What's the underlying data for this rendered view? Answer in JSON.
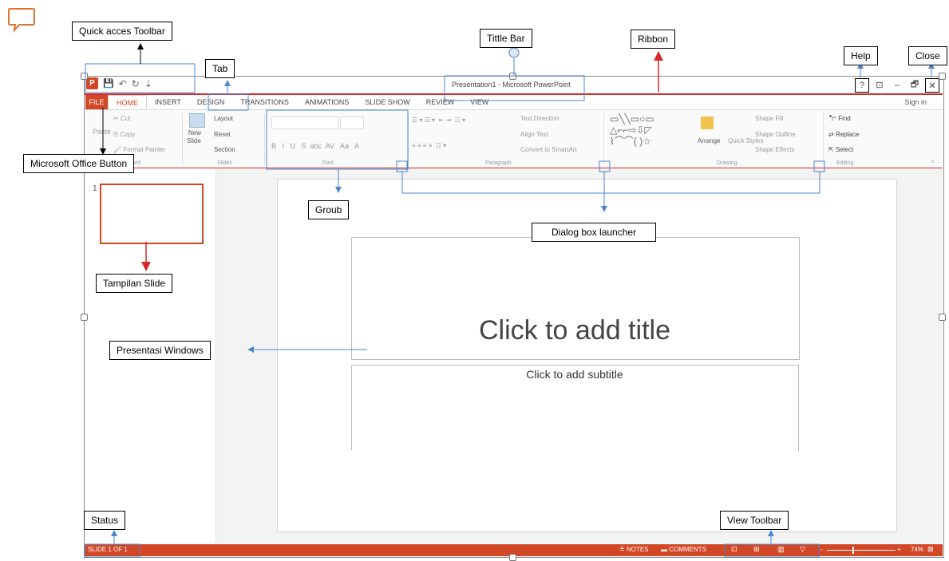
{
  "window": {
    "title": "Presentation1 - Microsoft PowerPoint",
    "controls": {
      "help": "?",
      "restore_ribbon": "⊡",
      "minimize": "–",
      "maximize": "🗗",
      "close": "✕"
    }
  },
  "qat": {
    "logo": "P",
    "save": "💾",
    "undo": "↶",
    "redo": "↻",
    "more": "⇣"
  },
  "tabs": {
    "file": "FILE",
    "home": "HOME",
    "insert": "INSERT",
    "design": "DESIGN",
    "transitions": "TRANSITIONS",
    "animations": "ANIMATIONS",
    "slideshow": "SLIDE SHOW",
    "review": "REVIEW",
    "view": "VIEW",
    "signin": "Sign in"
  },
  "ribbon": {
    "clipboard": {
      "paste": "Paste",
      "cut": "Cut",
      "copy": "Copy",
      "format_painter": "Format Painter",
      "label": "Clipboard"
    },
    "slides": {
      "new_slide": "New",
      "new_slide2": "Slide",
      "layout": "Layout",
      "reset": "Reset",
      "section": "Section",
      "label": "Slides"
    },
    "font": {
      "label": "Font",
      "bold": "B",
      "italic": "I",
      "underline": "U",
      "strike": "S",
      "abc": "abc",
      "av": "AV",
      "aa": "Aa",
      "a": "A"
    },
    "paragraph": {
      "label": "Paragraph",
      "text_direction": "Text Direction",
      "align_text": "Align Text",
      "convert": "Convert to SmartArt"
    },
    "drawing": {
      "label": "Drawing",
      "arrange": "Arrange",
      "quick_styles": "Quick Styles",
      "shape_fill": "Shape Fill",
      "shape_outline": "Shape Outline",
      "shape_effects": "Shape Effects"
    },
    "editing": {
      "label": "Editing",
      "find": "Find",
      "replace": "Replace",
      "select": "Select"
    }
  },
  "thumbnail": {
    "number": "1"
  },
  "slide": {
    "title_placeholder": "Click to add title",
    "subtitle_placeholder": "Click to add subtitle"
  },
  "status": {
    "slide_of": "SLIDE 1 OF 1",
    "notes": "NOTES",
    "comments": "COMMENTS",
    "zoom_minus": "-",
    "zoom_plus": "+",
    "zoom_percent": "74%"
  },
  "annotations": {
    "quick_access": "Quick acces Toolbar",
    "tab": "Tab",
    "title_bar": "Tittle Bar",
    "ribbon": "Ribbon",
    "help": "Help",
    "close": "Close",
    "office_button": "Microsoft Office Button",
    "group": "Groub",
    "dialog_launcher": "Dialog box launcher",
    "slide_view": "Tampilan Slide",
    "presentation_windows": "Presentasi Windows",
    "status": "Status",
    "view_toolbar": "View Toolbar"
  },
  "colors": {
    "accent": "#d24726",
    "annotation_line": "#4a86c8",
    "ribbon_highlight": "#d7282b"
  }
}
